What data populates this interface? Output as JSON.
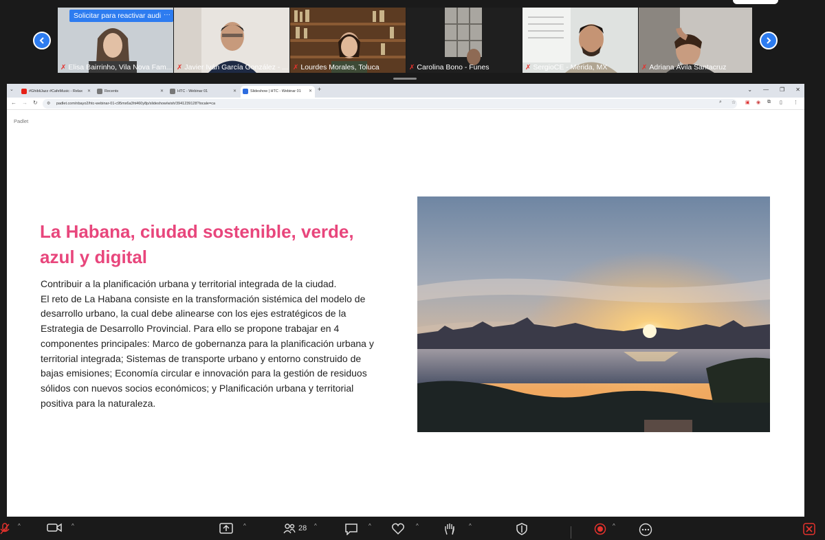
{
  "meeting": {
    "reactivate_audio_label": "Solicitar para reactivar audio",
    "tile_menu": "···",
    "participants": [
      {
        "name": "Elisa Bairrinho, Vila Nova Fam..."
      },
      {
        "name": "Javier Iván García González - ..."
      },
      {
        "name": "Lourdes Morales, Toluca"
      },
      {
        "name": "Carolina Bono - Funes"
      },
      {
        "name": "SergioCE - Mérida, MX"
      },
      {
        "name": "Adriana Ávila Santacruz"
      }
    ],
    "prev_icon": "chevron-left-icon",
    "next_icon": "chevron-right-icon"
  },
  "browser": {
    "tabs": [
      {
        "title": "#GhibliJazz #CafeMusic - Relax",
        "icon_color": "#e62117"
      },
      {
        "title": "Recents",
        "icon_color": "#555555"
      },
      {
        "title": "HTC - Webinar 01",
        "icon_color": "#555555"
      },
      {
        "title": "Slideshow | HTC - Webinar 01",
        "icon_color": "#2d6cdf"
      }
    ],
    "new_tab": "+",
    "window_controls": [
      "⌄",
      "—",
      "❐",
      "✕"
    ],
    "url": "padlet.com/nbayo2/htc-webinar-01-c95mx6a3ht460y8p/slideshow/wish/3941239128?locale=ca"
  },
  "slide": {
    "brand": "Padlet",
    "title": "La Habana, ciudad sostenible, verde, azul y digital",
    "body_lines": [
      "Contribuir a la planificación urbana y territorial integrada de la ciudad.",
      "El reto de La Habana consiste en la transformación sistémica del modelo de",
      "desarrollo urbano, la cual debe alinearse con los ejes estratégicos de la",
      "Estrategia de Desarrollo Provincial. Para ello se propone trabajar en 4",
      "componentes principales: Marco de gobernanza para la planificación urbana y",
      "territorial integrada; Sistemas de transporte urbano y entorno construido de",
      "bajas emisiones; Economía circular e innovación para la gestión de residuos",
      "sólidos con nuevos socios económicos; y Planificación urbana y territorial",
      "positiva para la naturaleza."
    ]
  },
  "toolbar": {
    "participants_count": "28",
    "accent": "#e5322d"
  }
}
